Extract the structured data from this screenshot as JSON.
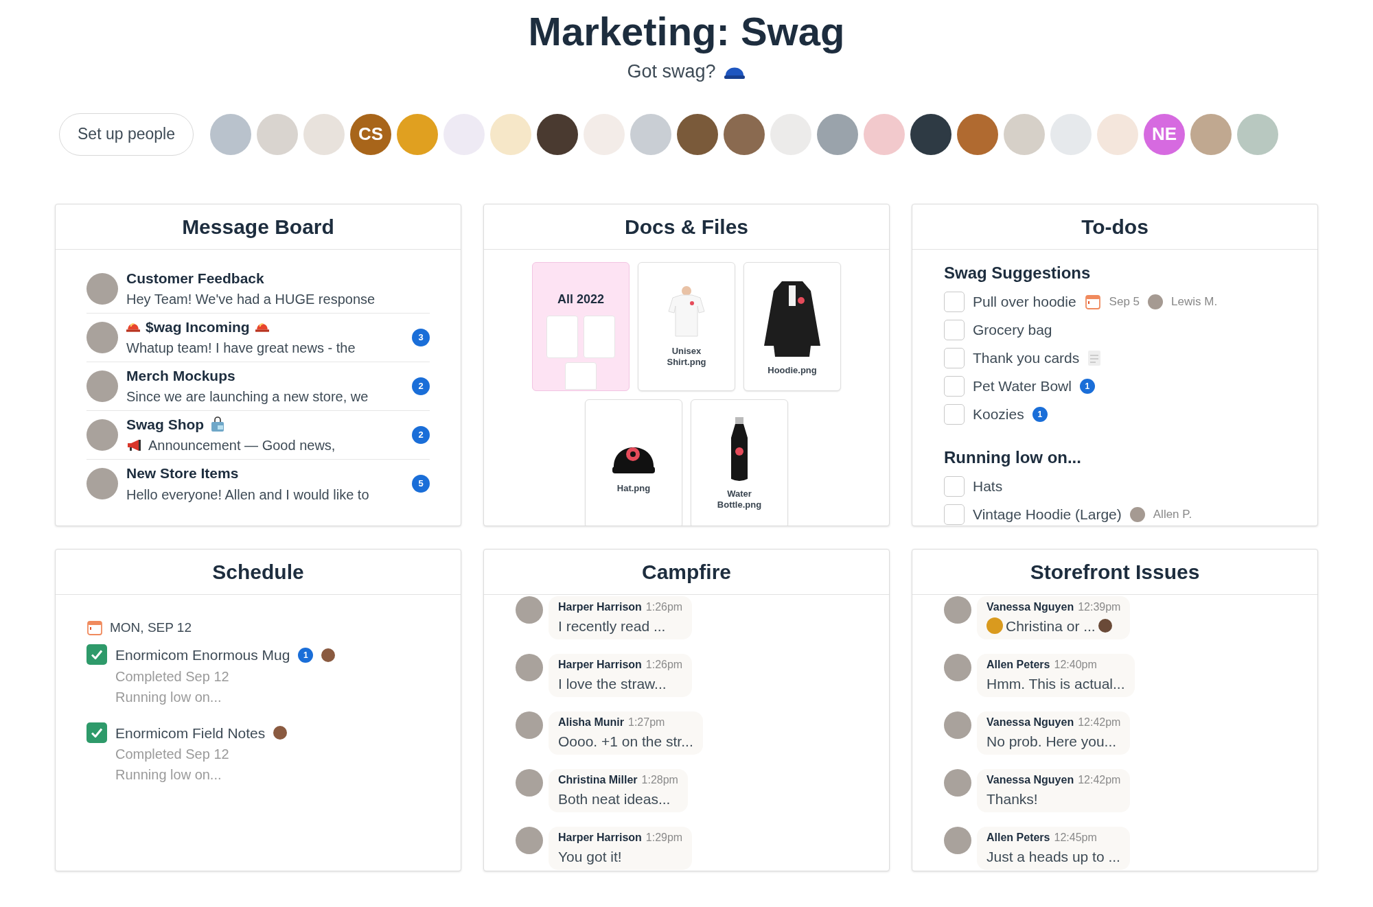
{
  "project": {
    "title": "Marketing: Swag",
    "subtitle": "Got swag?"
  },
  "people": {
    "button": "Set up people",
    "avatars": [
      {
        "kind": "photo",
        "color": "#b9c2cc"
      },
      {
        "kind": "photo",
        "color": "#d9d4cf"
      },
      {
        "kind": "photo",
        "color": "#e8e2dc"
      },
      {
        "kind": "initials",
        "initials": "CS",
        "color": "#a8651a"
      },
      {
        "kind": "photo",
        "color": "#e0a020"
      },
      {
        "kind": "photo",
        "color": "#eeeaf4"
      },
      {
        "kind": "photo",
        "color": "#f6e7c8"
      },
      {
        "kind": "photo",
        "color": "#4a3a30"
      },
      {
        "kind": "photo",
        "color": "#f3ece8"
      },
      {
        "kind": "photo",
        "color": "#c9ced4"
      },
      {
        "kind": "photo",
        "color": "#7a5a3a"
      },
      {
        "kind": "photo",
        "color": "#8a6a50"
      },
      {
        "kind": "photo",
        "color": "#ecebea"
      },
      {
        "kind": "photo",
        "color": "#9aa3ab"
      },
      {
        "kind": "photo",
        "color": "#f2c9cc"
      },
      {
        "kind": "photo",
        "color": "#2e3a44"
      },
      {
        "kind": "photo",
        "color": "#b06a30"
      },
      {
        "kind": "photo",
        "color": "#d6d0c8"
      },
      {
        "kind": "photo",
        "color": "#e6e9ec"
      },
      {
        "kind": "photo",
        "color": "#f4e6dc"
      },
      {
        "kind": "initials",
        "initials": "NE",
        "color": "#d66ae0"
      },
      {
        "kind": "photo",
        "color": "#c0a890"
      },
      {
        "kind": "photo",
        "color": "#b8c8c0"
      }
    ]
  },
  "message_board": {
    "title": "Message Board",
    "messages": [
      {
        "kind": "plain",
        "title": "Customer Feedback",
        "excerpt": "Hey Team! We've had a HUGE response"
      },
      {
        "kind": "alert",
        "title": "$wag Incoming",
        "excerpt": "Whatup team! I have great news - the",
        "badge": "3"
      },
      {
        "kind": "plain",
        "title": "Merch Mockups",
        "excerpt": "Since we are launching a new store, we",
        "badge": "2"
      },
      {
        "kind": "shop",
        "title": "Swag Shop",
        "excerpt": "Announcement — Good news,",
        "badge": "2"
      },
      {
        "kind": "plain",
        "title": "New Store Items",
        "excerpt": "Hello everyone! Allen and I would like to",
        "badge": "5"
      }
    ]
  },
  "docs": {
    "title": "Docs & Files",
    "items": [
      {
        "kind": "folder",
        "name": "All 2022"
      },
      {
        "kind": "shirt",
        "name": "Unisex Shirt.png"
      },
      {
        "kind": "hoodie",
        "name": "Hoodie.png"
      },
      {
        "kind": "hat",
        "name": "Hat.png"
      },
      {
        "kind": "bottle",
        "name": "Water Bottle.png"
      }
    ]
  },
  "todos": {
    "title": "To-dos",
    "groups": [
      {
        "name": "Swag Suggestions",
        "items": [
          {
            "text": "Pull over hoodie",
            "checked": false,
            "due": "Sep 5",
            "assignee": "Lewis M."
          },
          {
            "text": "Grocery bag",
            "checked": false
          },
          {
            "text": "Thank you cards",
            "checked": false,
            "note": true
          },
          {
            "text": "Pet Water Bowl",
            "checked": false,
            "badge": "1"
          },
          {
            "text": "Koozies",
            "checked": false,
            "badge": "1"
          }
        ]
      },
      {
        "name": "Running low on...",
        "items": [
          {
            "text": "Hats",
            "checked": false
          },
          {
            "text": "Vintage Hoodie (Large)",
            "checked": false,
            "assignee": "Allen P."
          }
        ]
      }
    ]
  },
  "schedule": {
    "title": "Schedule",
    "date": "MON, SEP 12",
    "items": [
      {
        "text": "Enormicom Enormous Mug",
        "checked": true,
        "badge": "1",
        "assigned": true,
        "status": "Completed Sep 12",
        "list": "Running low on..."
      },
      {
        "text": "Enormicom Field Notes",
        "checked": true,
        "assigned": true,
        "status": "Completed Sep 12",
        "list": "Running low on..."
      }
    ]
  },
  "campfire": {
    "title": "Campfire",
    "messages": [
      {
        "author": "Harper Harrison",
        "time": "1:26pm",
        "text": "I recently read ..."
      },
      {
        "author": "Harper Harrison",
        "time": "1:26pm",
        "text": "I love the straw..."
      },
      {
        "author": "Alisha Munir",
        "time": "1:27pm",
        "text": "Oooo. +1 on the str..."
      },
      {
        "author": "Christina Miller",
        "time": "1:28pm",
        "text": "Both neat ideas..."
      },
      {
        "author": "Harper Harrison",
        "time": "1:29pm",
        "text": "You got it!"
      }
    ]
  },
  "storefront": {
    "title": "Storefront Issues",
    "messages": [
      {
        "author": "Vanessa Nguyen",
        "time": "12:39pm",
        "text": "Christina or ...",
        "mentions": true
      },
      {
        "author": "Allen Peters",
        "time": "12:40pm",
        "text": "Hmm. This is actual..."
      },
      {
        "author": "Vanessa Nguyen",
        "time": "12:42pm",
        "text": "No prob. Here you..."
      },
      {
        "author": "Vanessa Nguyen",
        "time": "12:42pm",
        "text": "Thanks!"
      },
      {
        "author": "Allen Peters",
        "time": "12:45pm",
        "text": "Just a heads up to ..."
      }
    ]
  }
}
